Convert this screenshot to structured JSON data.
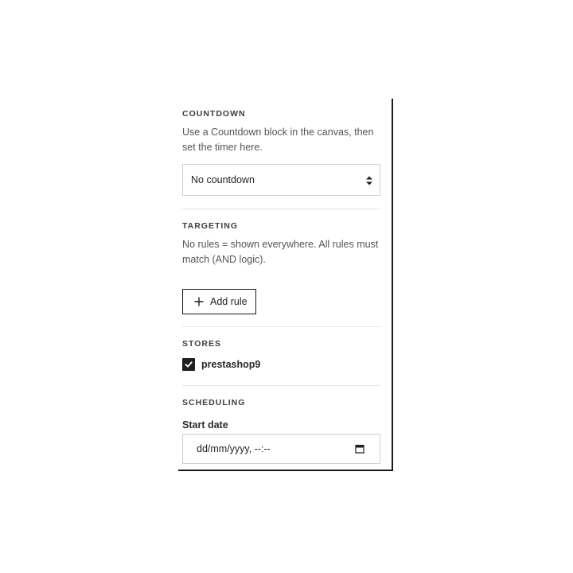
{
  "countdown": {
    "heading": "COUNTDOWN",
    "help": "Use a Countdown block in the canvas, then set the timer here.",
    "selected": "No countdown",
    "arrows_icon": "select-arrows-icon"
  },
  "targeting": {
    "heading": "TARGETING",
    "help": "No rules = shown everywhere. All rules must match (AND logic).",
    "add_rule_label": "Add rule",
    "add_icon": "plus-icon"
  },
  "stores": {
    "heading": "STORES",
    "items": [
      {
        "label": "prestashop9",
        "checked": true
      }
    ]
  },
  "scheduling": {
    "heading": "SCHEDULING",
    "start_date_label": "Start date",
    "start_date_placeholder": "dd/mm/yyyy, --:--",
    "calendar_icon": "calendar-icon"
  },
  "colors": {
    "border_dark": "#1a1a1a",
    "input_border": "#cfcfcf",
    "checkbox_fill": "#1f1f1f"
  }
}
